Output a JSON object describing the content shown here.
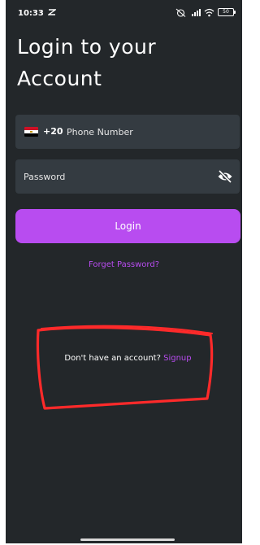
{
  "status_bar": {
    "time": "10:33",
    "battery": "50"
  },
  "login": {
    "title_line1": "Login to your",
    "title_line2": "Account",
    "country_code": "+20",
    "phone_placeholder": "Phone Number",
    "password_placeholder": "Password",
    "login_label": "Login",
    "forget_label": "Forget Password?",
    "no_account_text": "Don't have an account?",
    "signup_label": "Signup"
  },
  "icons": {
    "flag": "egypt-flag-icon",
    "password_toggle": "eye-off-icon"
  },
  "colors": {
    "background": "#23272a",
    "field": "#343b41",
    "accent": "#b84cf0",
    "annotation": "#ff2a2a"
  }
}
